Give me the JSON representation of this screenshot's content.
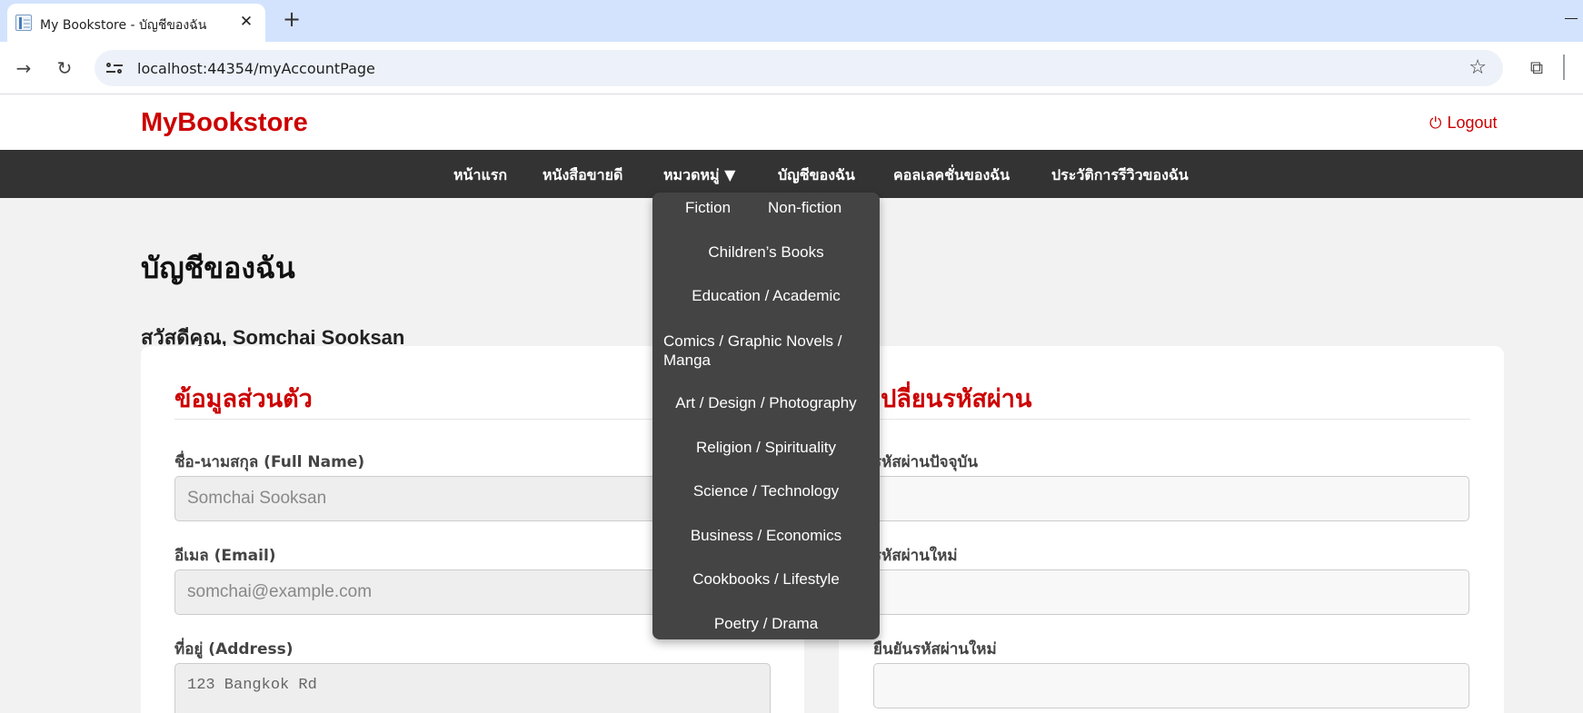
{
  "browser": {
    "tab_title": "My Bookstore - บัญชีของฉัน",
    "url": "localhost:44354/myAccountPage"
  },
  "site": {
    "logo": "MyBookstore",
    "logout_label": "Logout"
  },
  "nav": {
    "items": [
      "หน้าแรก",
      "หนังสือขายดี",
      "หมวดหมู่ ▼",
      "บัญชีของฉัน",
      "คอลเลคชั่นของฉัน",
      "ประวัติการรีวิวของฉัน"
    ]
  },
  "categories": {
    "items": [
      "Fiction",
      "Non-fiction",
      "Children’s Books",
      "Education / Academic",
      "Comics / Graphic Novels / Manga",
      "Art / Design / Photography",
      "Religion / Spirituality",
      "Science / Technology",
      "Business / Economics",
      "Cookbooks / Lifestyle",
      "Poetry / Drama"
    ]
  },
  "page": {
    "title": "บัญชีของฉัน",
    "greeting": "สวัสดีคุณ, Somchai Sooksan"
  },
  "personal": {
    "heading": "ข้อมูลส่วนตัว",
    "fullname_label": "ชื่อ-นามสกุล (Full Name)",
    "fullname_value": "Somchai Sooksan",
    "email_label": "อีเมล (Email)",
    "email_value": "somchai@example.com",
    "address_label": "ที่อยู่ (Address)",
    "address_value": "123 Bangkok Rd"
  },
  "password": {
    "heading": "เปลี่ยนรหัสผ่าน",
    "current_label": "รหัสผ่านปัจจุบัน",
    "new_label": "รหัสผ่านใหม่",
    "confirm_label": "ยืนยันรหัสผ่านใหม่"
  },
  "colors": {
    "brand": "#cc0000",
    "nav_bg": "#333333",
    "dropdown_bg": "#444444"
  },
  "icons": {
    "forward": "arrow-right-icon",
    "reload": "reload-icon",
    "site_info": "site-info-icon",
    "bookmark": "star-icon",
    "extensions": "puzzle-icon",
    "logout": "power-icon"
  }
}
